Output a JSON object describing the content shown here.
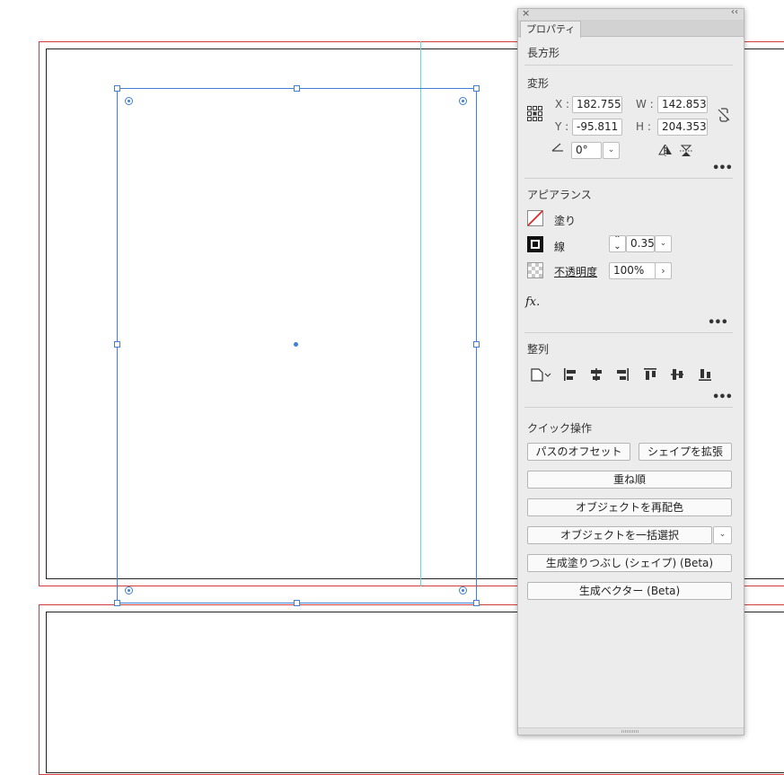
{
  "panel": {
    "close_glyph": "×",
    "collapse_glyph": "‹‹",
    "tab_label": "プロパティ",
    "object_type": "長方形"
  },
  "transform": {
    "title": "変形",
    "x_label": "X :",
    "x_value": "182.755",
    "y_label": "Y :",
    "y_value": "-95.811",
    "w_label": "W :",
    "w_value": "142.853",
    "h_label": "H :",
    "h_value": "204.353",
    "angle_value": "0°"
  },
  "appearance": {
    "title": "アピアランス",
    "fill_label": "塗り",
    "stroke_label": "線",
    "stroke_weight": "0.35",
    "opacity_label": "不透明度",
    "opacity_value": "100%",
    "fx_label": "fx."
  },
  "align": {
    "title": "整列"
  },
  "quick_actions": {
    "title": "クイック操作",
    "offset_path": "パスのオフセット",
    "expand_shape": "シェイプを拡張",
    "arrange": "重ね順",
    "recolor": "オブジェクトを再配色",
    "select_same": "オブジェクトを一括選択",
    "generative_fill": "生成塗りつぶし (シェイプ) (Beta)",
    "generative_vector": "生成ベクター (Beta)"
  },
  "more_glyph": "•••",
  "colors": {
    "selection": "#3f7fd6",
    "bleed": "#d23c3c",
    "guide": "#63d9d4",
    "panel_bg": "#ececec"
  }
}
